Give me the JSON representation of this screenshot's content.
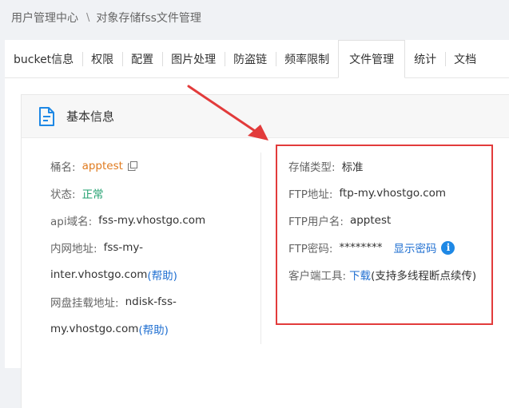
{
  "breadcrumb": {
    "root": "用户管理中心",
    "separator": "\\",
    "current": "对象存储fss文件管理"
  },
  "tabs": [
    {
      "label": "bucket信息"
    },
    {
      "label": "权限"
    },
    {
      "label": "配置"
    },
    {
      "label": "图片处理"
    },
    {
      "label": "防盗链"
    },
    {
      "label": "频率限制"
    },
    {
      "label": "文件管理",
      "active": true
    },
    {
      "label": "统计"
    },
    {
      "label": "文档"
    }
  ],
  "panel": {
    "title": "基本信息",
    "icon": "document-icon"
  },
  "basic_info": {
    "bucket_label": "桶名:",
    "bucket_value": "apptest",
    "status_label": "状态:",
    "status_value": "正常",
    "api_label": "api域名:",
    "api_value": "fss-my.vhostgo.com",
    "intranet_label": "内网地址:",
    "intranet_value_1": "fss-my-",
    "intranet_value_2": "inter.vhostgo.com",
    "intranet_help": "(帮助)",
    "mount_label": "网盘挂载地址:",
    "mount_value_1": "ndisk-fss-",
    "mount_value_2": "my.vhostgo.com",
    "mount_help": "(帮助)"
  },
  "ftp_info": {
    "storage_label": "存储类型:",
    "storage_value": "标准",
    "ftp_addr_label": "FTP地址:",
    "ftp_addr_value": "ftp-my.vhostgo.com",
    "ftp_user_label": "FTP用户名:",
    "ftp_user_value": "apptest",
    "ftp_pwd_label": "FTP密码:",
    "ftp_pwd_value": "********",
    "show_pwd": "显示密码",
    "client_label": "客户端工具:",
    "client_link": "下载",
    "client_note": "(支持多线程断点续传)"
  },
  "colors": {
    "highlight": "#e23b3b",
    "link": "#1f6fd1",
    "accent_orange": "#e07b1f",
    "status_green": "#21a06f"
  }
}
